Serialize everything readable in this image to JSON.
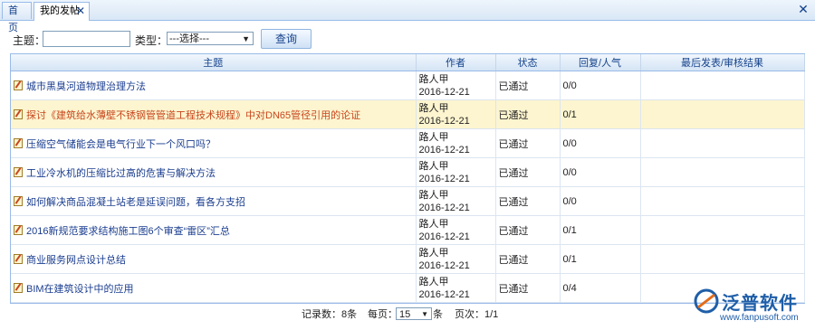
{
  "tabs": {
    "home": "首页",
    "my_posts": "我的发帖",
    "close_glyph": "✕"
  },
  "search": {
    "subject_label": "主题：",
    "type_label": "类型：",
    "type_value": "---选择---",
    "query_button": "查询"
  },
  "table": {
    "headers": [
      "主题",
      "作者",
      "状态",
      "回复/人气",
      "最后发表/审核结果"
    ],
    "rows": [
      {
        "subject": "城市黑臭河道物理治理方法",
        "author": "路人甲",
        "date": "2016-12-21",
        "status": "已通过",
        "replies": "0/0",
        "last": ""
      },
      {
        "subject": "探讨《建筑给水薄壁不锈钢管管道工程技术规程》中对DN65管径引用的论证",
        "author": "路人甲",
        "date": "2016-12-21",
        "status": "已通过",
        "replies": "0/1",
        "last": ""
      },
      {
        "subject": "压缩空气储能会是电气行业下一个风口吗？",
        "author": "路人甲",
        "date": "2016-12-21",
        "status": "已通过",
        "replies": "0/0",
        "last": ""
      },
      {
        "subject": "工业冷水机的压缩比过高的危害与解决方法",
        "author": "路人甲",
        "date": "2016-12-21",
        "status": "已通过",
        "replies": "0/0",
        "last": ""
      },
      {
        "subject": "如何解决商品混凝土站老是延误问题，看各方支招",
        "author": "路人甲",
        "date": "2016-12-21",
        "status": "已通过",
        "replies": "0/0",
        "last": ""
      },
      {
        "subject": "2016新规范要求结构施工图6个审查“雷区”汇总",
        "author": "路人甲",
        "date": "2016-12-21",
        "status": "已通过",
        "replies": "0/1",
        "last": ""
      },
      {
        "subject": "商业服务网点设计总结",
        "author": "路人甲",
        "date": "2016-12-21",
        "status": "已通过",
        "replies": "0/1",
        "last": ""
      },
      {
        "subject": "BIM在建筑设计中的应用",
        "author": "路人甲",
        "date": "2016-12-21",
        "status": "已通过",
        "replies": "0/4",
        "last": ""
      }
    ]
  },
  "pager": {
    "records": "记录数：8条",
    "per_page_label": "每页：",
    "per_page_value": "15",
    "per_page_unit": "条",
    "pages": "页次：1/1"
  },
  "logo": {
    "name": "泛普软件",
    "url": "www.fanpusoft.com"
  },
  "colors": {
    "accent": "#15428b",
    "link": "#1a3d8f",
    "selected_row": "#fdf5cf",
    "selected_link": "#c8461e",
    "logo": "#1f5ea8"
  }
}
